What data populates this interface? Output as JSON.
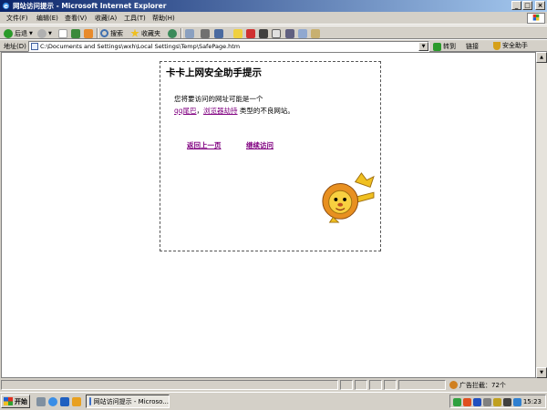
{
  "window": {
    "title": "网站访问提示 - Microsoft Internet Explorer",
    "controls": {
      "minimize": "_",
      "maximize": "□",
      "close": "×"
    }
  },
  "menu": [
    "文件(F)",
    "编辑(E)",
    "查看(V)",
    "收藏(A)",
    "工具(T)",
    "帮助(H)"
  ],
  "toolbar": {
    "back": "后退",
    "search": "搜索",
    "favorites": "收藏夹"
  },
  "address": {
    "label": "地址(D)",
    "url": "C:\\Documents and Settings\\wxh\\Local Settings\\Temp\\SafePage.htm",
    "go": "转到",
    "links": "链接",
    "security": "安全助手"
  },
  "page": {
    "heading": "卡卡上网安全助手提示",
    "line1": "您将要访问的网址可能是一个",
    "type1": "qq尾巴",
    "sep": "，",
    "type2": "浏览器劫持",
    "line2_tail": " 类型的不良网站。",
    "back_link": "返回上一页",
    "continue_link": "继续访问"
  },
  "status": {
    "ad_block": "广告拦截：72个"
  },
  "taskbar": {
    "start": "开始",
    "window_item": "网站访问提示 - Microso...",
    "clock": "15:23"
  },
  "colors": {
    "titlebar_start": "#0a246a",
    "titlebar_end": "#a6caf0",
    "visited_link": "#800080",
    "chrome": "#d4d0c8"
  }
}
